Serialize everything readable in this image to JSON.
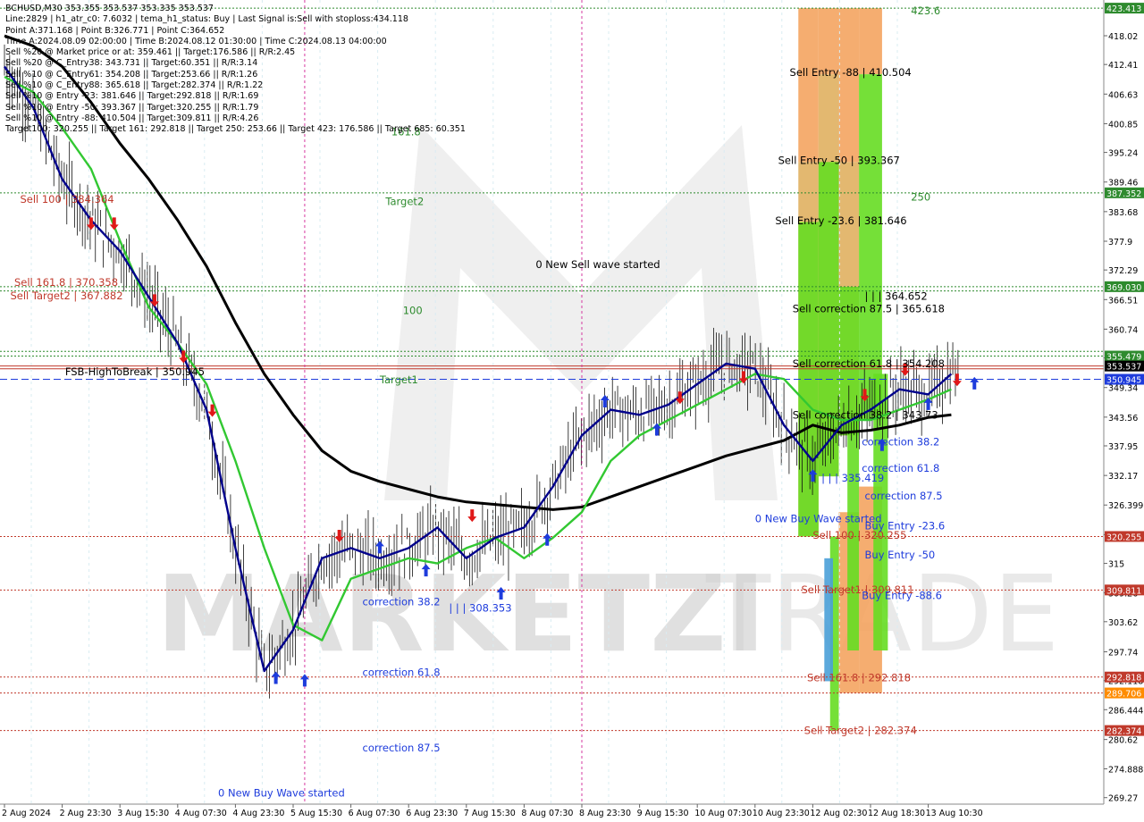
{
  "info_lines": [
    "BCHUSD,M30  353.355 353.537 353.335 353.537",
    "Line:2829 | h1_atr_c0: 7.6032 | tema_h1_status: Buy | Last Signal is:Sell with stoploss:434.118",
    "Point A:371.168 | Point B:326.771 | Point C:364.652",
    "Time A:2024.08.09 02:00:00 | Time B:2024.08.12 01:30:00 | Time C:2024.08.13 04:00:00",
    "Sell %20 @ Market price or at: 359.461 || Target:176.586 || R/R:2.45",
    "Sell %20 @ C_Entry38: 343.731 || Target:60.351 || R/R:3.14",
    "Sell %10 @ C_Entry61: 354.208 || Target:253.66 || R/R:1.26",
    "Sell %10 @ C_Entry88: 365.618 || Target:282.374 || R/R:1.22",
    "Sell %10 @ Entry -23: 381.646 || Target:292.818 || R/R:1.69",
    "Sell %10 @ Entry -50: 393.367 || Target:320.255 || R/R:1.79",
    "Sell %10 @ Entry -88: 410.504 || Target:309.811 || R/R:4.26",
    "Target100: 320.255 || Target 161: 292.818 || Target 250: 253.66 || Target 423: 176.586 || Target 685: 60.351"
  ],
  "watermark": {
    "text_left": "MARKETZI",
    "text_right": "TRADE"
  },
  "chart_data": {
    "type": "line",
    "symbol": "BCHUSD,M30",
    "ylim": [
      268.0,
      425.0
    ],
    "y_ticks": [
      269.27,
      274.888,
      280.62,
      286.444,
      292.118,
      297.74,
      303.62,
      309.26,
      315.0,
      320.62,
      326.399,
      332.17,
      337.95,
      343.56,
      349.34,
      355.12,
      360.74,
      366.51,
      372.29,
      377.9,
      383.68,
      389.46,
      395.24,
      400.85,
      406.63,
      412.41,
      418.02
    ],
    "x_labels": [
      "2 Aug 2024",
      "2 Aug 23:30",
      "3 Aug 15:30",
      "4 Aug 07:30",
      "4 Aug 23:30",
      "5 Aug 15:30",
      "6 Aug 07:30",
      "6 Aug 23:30",
      "7 Aug 15:30",
      "8 Aug 07:30",
      "8 Aug 23:30",
      "9 Aug 15:30",
      "10 Aug 07:30",
      "10 Aug 23:30",
      "12 Aug 02:30",
      "12 Aug 18:30",
      "13 Aug 10:30"
    ],
    "x_count": 16,
    "price_now": 353.537,
    "price_badges": [
      {
        "text": "423.413",
        "value": 423.413,
        "color": "#2e8b2e"
      },
      {
        "text": "387.352",
        "value": 387.352,
        "color": "#2e8b2e"
      },
      {
        "text": "369.030",
        "value": 369.03,
        "color": "#2e8b2e"
      },
      {
        "text": "355.479",
        "value": 355.479,
        "color": "#2e8b2e"
      },
      {
        "text": "353.537",
        "value": 353.537,
        "color": "#000000"
      },
      {
        "text": "350.945",
        "value": 350.945,
        "color": "#1e3cdc"
      },
      {
        "text": "320.255",
        "value": 320.255,
        "color": "#c0392b"
      },
      {
        "text": "309.811",
        "value": 309.811,
        "color": "#c0392b"
      },
      {
        "text": "292.818",
        "value": 292.818,
        "color": "#c0392b"
      },
      {
        "text": "289.706",
        "value": 289.706,
        "color": "#ff8c00"
      },
      {
        "text": "282.374",
        "value": 282.374,
        "color": "#c0392b"
      }
    ],
    "hlines": [
      {
        "value": 423.413,
        "color": "#2e8b2e",
        "style": "dot"
      },
      {
        "value": 387.352,
        "color": "#2e8b2e",
        "style": "dot"
      },
      {
        "value": 369.03,
        "color": "#2e8b2e",
        "style": "dot"
      },
      {
        "value": 368.2,
        "color": "#2e8b2e",
        "style": "dot"
      },
      {
        "value": 356.4,
        "color": "#2e8b2e",
        "style": "dot"
      },
      {
        "value": 355.479,
        "color": "#2e8b2e",
        "style": "dot"
      },
      {
        "value": 353.537,
        "color": "#c0392b",
        "style": "solid"
      },
      {
        "value": 353.0,
        "color": "#c0392b",
        "style": "solid"
      },
      {
        "value": 350.945,
        "color": "#1e3cdc",
        "style": "dash"
      },
      {
        "value": 320.255,
        "color": "#c0392b",
        "style": "dot"
      },
      {
        "value": 309.811,
        "color": "#c0392b",
        "style": "dot"
      },
      {
        "value": 292.818,
        "color": "#c0392b",
        "style": "dot"
      },
      {
        "value": 289.706,
        "color": "#c0392b",
        "style": "dot"
      },
      {
        "value": 282.374,
        "color": "#c0392b",
        "style": "dot"
      }
    ],
    "vlines": [
      {
        "x": 5.2,
        "color": "#d63aa0"
      },
      {
        "x": 10.0,
        "color": "#d63aa0"
      }
    ],
    "zones": [
      {
        "x0": 13.75,
        "x1": 14.1,
        "y0": 393.367,
        "y1": 423.413,
        "color": "#f4a460"
      },
      {
        "x0": 14.1,
        "x1": 14.45,
        "y0": 410.504,
        "y1": 423.413,
        "color": "#f4a460"
      },
      {
        "x0": 14.45,
        "x1": 14.8,
        "y0": 393.367,
        "y1": 423.413,
        "color": "#f4a460"
      },
      {
        "x0": 14.8,
        "x1": 15.2,
        "y0": 410.504,
        "y1": 423.413,
        "color": "#f4a460"
      },
      {
        "x0": 13.75,
        "x1": 14.1,
        "y0": 320.255,
        "y1": 393.367,
        "color": "#e0b060"
      },
      {
        "x0": 13.75,
        "x1": 14.1,
        "y0": 320.255,
        "y1": 381.646,
        "color": "#66dd22"
      },
      {
        "x0": 14.1,
        "x1": 14.45,
        "y0": 332.0,
        "y1": 410.504,
        "color": "#e0b060"
      },
      {
        "x0": 14.1,
        "x1": 14.45,
        "y0": 332.0,
        "y1": 393.367,
        "color": "#66dd22"
      },
      {
        "x0": 14.45,
        "x1": 14.8,
        "y0": 340.0,
        "y1": 393.367,
        "color": "#e0b060"
      },
      {
        "x0": 14.45,
        "x1": 14.8,
        "y0": 340.0,
        "y1": 369.0,
        "color": "#66dd22"
      },
      {
        "x0": 14.8,
        "x1": 15.2,
        "y0": 343.0,
        "y1": 410.504,
        "color": "#66dd22"
      },
      {
        "x0": 14.3,
        "x1": 14.45,
        "y0": 282.374,
        "y1": 320.255,
        "color": "#66dd22"
      },
      {
        "x0": 14.45,
        "x1": 14.8,
        "y0": 289.706,
        "y1": 325.0,
        "color": "#f4a460"
      },
      {
        "x0": 14.8,
        "x1": 15.2,
        "y0": 289.706,
        "y1": 330.0,
        "color": "#f4a460"
      },
      {
        "x0": 14.6,
        "x1": 14.8,
        "y0": 298.0,
        "y1": 343.0,
        "color": "#66dd22"
      },
      {
        "x0": 15.05,
        "x1": 15.3,
        "y0": 298.0,
        "y1": 352.0,
        "color": "#66dd22"
      },
      {
        "x0": 14.2,
        "x1": 14.35,
        "y0": 292.0,
        "y1": 316.0,
        "color": "#4aa0d8"
      }
    ],
    "series": [
      {
        "name": "",
        "color": "#000000",
        "x": [
          0.0,
          0.5,
          1.0,
          1.5,
          2.0,
          2.5,
          3.0,
          3.5,
          4.0,
          4.5,
          5.0,
          5.5,
          6.0,
          6.5,
          7.0,
          7.5,
          8.0,
          8.5,
          9.0,
          9.5,
          10.0,
          10.5,
          11.0,
          11.5,
          12.0,
          12.5,
          13.0,
          13.5,
          14.0,
          14.5,
          15.0,
          15.5,
          16.0,
          16.4
        ],
        "values": [
          418,
          416,
          412,
          405,
          397,
          390,
          382,
          373,
          362,
          352,
          344,
          337,
          333,
          331,
          329.5,
          328,
          327,
          326.5,
          326,
          325.5,
          326,
          328,
          330,
          332,
          334,
          336,
          337.5,
          339,
          342,
          340.5,
          341,
          342,
          343.5,
          344
        ]
      },
      {
        "name": "",
        "color": "#32c832",
        "x": [
          0.0,
          0.5,
          1.0,
          1.5,
          2.0,
          2.5,
          3.0,
          3.5,
          4.0,
          4.5,
          5.0,
          5.5,
          6.0,
          6.5,
          7.0,
          7.5,
          8.0,
          8.5,
          9.0,
          9.5,
          10.0,
          10.5,
          11.0,
          11.5,
          12.0,
          12.5,
          13.0,
          13.5,
          14.0,
          14.5,
          15.0,
          15.5,
          16.0,
          16.4
        ],
        "values": [
          410,
          407,
          400,
          392,
          378,
          365,
          358,
          350,
          335,
          318,
          303,
          300,
          312,
          314,
          316,
          315,
          318,
          320,
          316,
          320,
          325,
          335,
          340,
          343,
          346,
          349,
          352,
          351,
          345,
          343,
          343,
          345,
          347,
          349
        ]
      },
      {
        "name": "",
        "color": "#00008b",
        "x": [
          0.0,
          0.5,
          1.0,
          1.5,
          2.0,
          2.5,
          3.0,
          3.5,
          4.0,
          4.5,
          5.0,
          5.5,
          6.0,
          6.5,
          7.0,
          7.5,
          8.0,
          8.5,
          9.0,
          9.5,
          10.0,
          10.5,
          11.0,
          11.5,
          12.0,
          12.5,
          13.0,
          13.5,
          14.0,
          14.5,
          15.0,
          15.5,
          16.0,
          16.4
        ],
        "values": [
          412,
          404,
          390,
          382,
          376,
          367,
          358,
          345,
          318,
          294,
          302,
          316,
          318,
          316,
          318,
          322,
          316,
          320,
          322,
          330,
          340,
          345,
          344,
          346,
          350,
          354,
          353,
          342,
          335,
          342,
          345,
          349,
          348,
          352
        ]
      }
    ],
    "markers": [
      {
        "x": 1.5,
        "y": 381.5,
        "dir": "sell"
      },
      {
        "x": 1.9,
        "y": 381.5,
        "dir": "sell"
      },
      {
        "x": 2.6,
        "y": 366.5,
        "dir": "sell"
      },
      {
        "x": 3.1,
        "y": 355.5,
        "dir": "sell"
      },
      {
        "x": 3.6,
        "y": 345.0,
        "dir": "sell"
      },
      {
        "x": 4.7,
        "y": 292.5,
        "dir": "buy"
      },
      {
        "x": 5.2,
        "y": 292.0,
        "dir": "buy"
      },
      {
        "x": 5.8,
        "y": 320.5,
        "dir": "sell"
      },
      {
        "x": 6.5,
        "y": 318.0,
        "dir": "buy"
      },
      {
        "x": 7.3,
        "y": 313.5,
        "dir": "buy"
      },
      {
        "x": 8.1,
        "y": 324.5,
        "dir": "sell"
      },
      {
        "x": 8.6,
        "y": 309.0,
        "dir": "buy"
      },
      {
        "x": 9.4,
        "y": 319.5,
        "dir": "buy"
      },
      {
        "x": 10.4,
        "y": 346.5,
        "dir": "buy"
      },
      {
        "x": 11.3,
        "y": 341.0,
        "dir": "buy"
      },
      {
        "x": 11.7,
        "y": 347.5,
        "dir": "sell"
      },
      {
        "x": 12.8,
        "y": 351.5,
        "dir": "sell"
      },
      {
        "x": 14.0,
        "y": 332.0,
        "dir": "buy"
      },
      {
        "x": 14.9,
        "y": 348.0,
        "dir": "sell"
      },
      {
        "x": 15.2,
        "y": 338.0,
        "dir": "buy"
      },
      {
        "x": 15.6,
        "y": 353.0,
        "dir": "sell"
      },
      {
        "x": 16.0,
        "y": 346.0,
        "dir": "buy"
      },
      {
        "x": 16.5,
        "y": 351.0,
        "dir": "sell"
      },
      {
        "x": 16.8,
        "y": 350.0,
        "dir": "buy"
      }
    ],
    "annotations": [
      {
        "x": 0.27,
        "y": 385.4,
        "text": "Sell 100 | 384.364",
        "color": "#c0392b"
      },
      {
        "x": 0.17,
        "y": 369.2,
        "text": "Sell 161.8 | 370.358",
        "color": "#c0392b"
      },
      {
        "x": 0.1,
        "y": 366.6,
        "text": "Sell Target2 | 367.882",
        "color": "#c0392b"
      },
      {
        "x": 1.05,
        "y": 351.7,
        "text": "FSB-HighToBreak | 350.945",
        "color": "#000000"
      },
      {
        "x": 6.6,
        "y": 385.0,
        "text": "Target2",
        "color": "#2e8b2e"
      },
      {
        "x": 6.9,
        "y": 363.7,
        "text": "100",
        "color": "#2e8b2e"
      },
      {
        "x": 6.5,
        "y": 350.2,
        "text": "Target1",
        "color": "#2e8b2e"
      },
      {
        "x": 6.7,
        "y": 398.6,
        "text": "161.8",
        "color": "#2e8b2e"
      },
      {
        "x": 9.2,
        "y": 372.7,
        "text": "0 New Sell wave started",
        "color": "#000000"
      },
      {
        "x": 6.2,
        "y": 306.8,
        "text": "correction 38.2",
        "color": "#1e3cdc"
      },
      {
        "x": 7.7,
        "y": 305.6,
        "text": "| | | 308.353",
        "color": "#1e3cdc"
      },
      {
        "x": 6.2,
        "y": 293.0,
        "text": "correction 61.8",
        "color": "#1e3cdc"
      },
      {
        "x": 6.2,
        "y": 278.3,
        "text": "correction 87.5",
        "color": "#1e3cdc"
      },
      {
        "x": 3.7,
        "y": 269.5,
        "text": "0 New Buy Wave started",
        "color": "#1e3cdc"
      },
      {
        "x": 15.7,
        "y": 422.2,
        "text": "423.6",
        "color": "#2e8b2e"
      },
      {
        "x": 13.6,
        "y": 410.2,
        "text": "Sell Entry -88 | 410.504",
        "color": "#000000"
      },
      {
        "x": 13.4,
        "y": 393.0,
        "text": "Sell Entry -50 | 393.367",
        "color": "#000000"
      },
      {
        "x": 15.7,
        "y": 385.8,
        "text": "250",
        "color": "#2e8b2e"
      },
      {
        "x": 13.35,
        "y": 381.2,
        "text": "Sell Entry -23.6 | 381.646",
        "color": "#000000"
      },
      {
        "x": 14.9,
        "y": 366.5,
        "text": "| | | 364.652",
        "color": "#000000"
      },
      {
        "x": 13.65,
        "y": 364.0,
        "text": "Sell correction 87.5 | 365.618",
        "color": "#000000"
      },
      {
        "x": 13.65,
        "y": 353.3,
        "text": "Sell correction 61.8 | 354.208",
        "color": "#000000"
      },
      {
        "x": 13.65,
        "y": 343.3,
        "text": "Sell correction 38.2 | 343.73",
        "color": "#000000"
      },
      {
        "x": 14.85,
        "y": 338.0,
        "text": "correction 38.2",
        "color": "#1e3cdc"
      },
      {
        "x": 14.85,
        "y": 332.9,
        "text": "correction 61.8",
        "color": "#1e3cdc"
      },
      {
        "x": 14.15,
        "y": 331.0,
        "text": "| | | 335.419",
        "color": "#1e3cdc"
      },
      {
        "x": 14.9,
        "y": 327.5,
        "text": "correction 87.5",
        "color": "#1e3cdc"
      },
      {
        "x": 13.0,
        "y": 323.0,
        "text": "0 New Buy Wave started",
        "color": "#1e3cdc"
      },
      {
        "x": 14.0,
        "y": 319.8,
        "text": "Sell 100 | 320.255",
        "color": "#c0392b"
      },
      {
        "x": 14.9,
        "y": 321.6,
        "text": "Buy Entry -23.6",
        "color": "#1e3cdc"
      },
      {
        "x": 14.9,
        "y": 316.0,
        "text": "Buy Entry -50",
        "color": "#1e3cdc"
      },
      {
        "x": 13.8,
        "y": 309.2,
        "text": "Sell Target1 | 309.811",
        "color": "#c0392b"
      },
      {
        "x": 14.85,
        "y": 308.0,
        "text": "Buy Entry -88.6",
        "color": "#1e3cdc"
      },
      {
        "x": 13.9,
        "y": 292.0,
        "text": "Sell 161.8 | 292.818",
        "color": "#c0392b"
      },
      {
        "x": 13.85,
        "y": 281.7,
        "text": "Sell Target2 | 282.374",
        "color": "#c0392b"
      }
    ]
  }
}
